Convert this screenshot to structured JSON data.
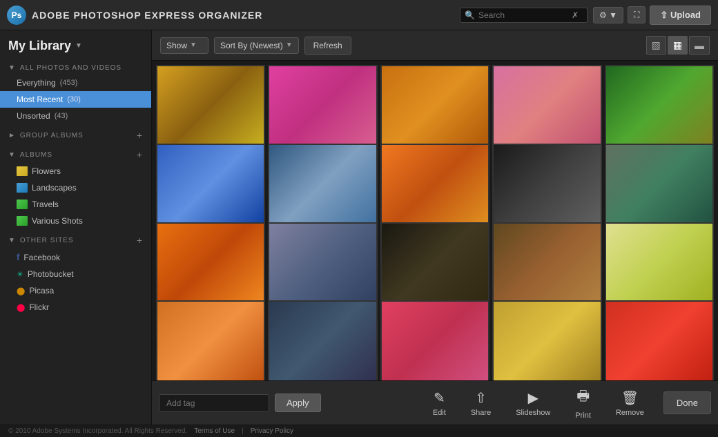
{
  "header": {
    "app_name": "ADOBE PHOTOSHOP EXPRESS ORGANIZER",
    "search_placeholder": "Search",
    "settings_label": "Settings",
    "fullscreen_label": "Fullscreen",
    "upload_label": "Upload"
  },
  "sidebar": {
    "library_title": "My Library",
    "sections": {
      "all_photos": {
        "title": "ALL PHOTOS AND VIDEOS",
        "items": [
          {
            "label": "Everything",
            "count": "(453)"
          },
          {
            "label": "Most Recent",
            "count": "(30)",
            "active": true
          },
          {
            "label": "Unsorted",
            "count": "(43)"
          }
        ]
      },
      "group_albums": {
        "title": "GROUP ALBUMS"
      },
      "albums": {
        "title": "ALBUMS",
        "items": [
          {
            "label": "Flowers",
            "icon": "flowers"
          },
          {
            "label": "Landscapes",
            "icon": "landscapes"
          },
          {
            "label": "Travels",
            "icon": "travels"
          },
          {
            "label": "Various Shots",
            "icon": "various"
          }
        ]
      },
      "other_sites": {
        "title": "OTHER SITES",
        "items": [
          {
            "label": "Facebook",
            "icon": "facebook"
          },
          {
            "label": "Photobucket",
            "icon": "photobucket"
          },
          {
            "label": "Picasa",
            "icon": "picasa"
          },
          {
            "label": "Flickr",
            "icon": "flickr"
          }
        ]
      }
    },
    "footer": "© 2010 Adobe Systems Incorporated. All Rights Reserved."
  },
  "toolbar": {
    "show_label": "Show",
    "sort_label": "Sort By (Newest)",
    "refresh_label": "Refresh"
  },
  "photos": {
    "items": [
      {
        "id": 1,
        "color": "p1"
      },
      {
        "id": 2,
        "color": "p2"
      },
      {
        "id": 3,
        "color": "p3"
      },
      {
        "id": 4,
        "color": "p4"
      },
      {
        "id": 5,
        "color": "p5"
      },
      {
        "id": 6,
        "color": "p6"
      },
      {
        "id": 7,
        "color": "p7"
      },
      {
        "id": 8,
        "color": "p8"
      },
      {
        "id": 9,
        "color": "p9"
      },
      {
        "id": 10,
        "color": "p10"
      },
      {
        "id": 11,
        "color": "p11"
      },
      {
        "id": 12,
        "color": "p12"
      },
      {
        "id": 13,
        "color": "p13"
      },
      {
        "id": 14,
        "color": "p14"
      },
      {
        "id": 15,
        "color": "p15"
      },
      {
        "id": 16,
        "color": "p16"
      },
      {
        "id": 17,
        "color": "p17"
      },
      {
        "id": 18,
        "color": "p18"
      },
      {
        "id": 19,
        "color": "p19"
      },
      {
        "id": 20,
        "color": "p20"
      }
    ]
  },
  "bottom": {
    "tag_placeholder": "Add tag",
    "apply_label": "Apply",
    "edit_label": "Edit",
    "share_label": "Share",
    "slideshow_label": "Slideshow",
    "print_label": "Print",
    "remove_label": "Remove",
    "done_label": "Done"
  },
  "footer": {
    "copyright": "© 2010 Adobe Systems Incorporated. All Rights Reserved.",
    "terms_label": "Terms of Use",
    "privacy_label": "Privacy Policy"
  }
}
